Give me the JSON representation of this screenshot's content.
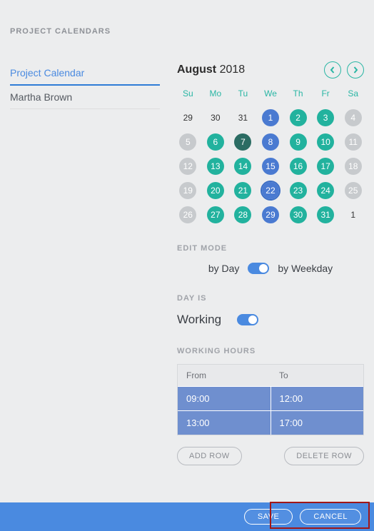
{
  "page_title": "PROJECT CALENDARS",
  "sidebar": {
    "items": [
      {
        "label": "Project Calendar",
        "active": true
      },
      {
        "label": "Martha Brown",
        "active": false
      }
    ]
  },
  "calendar": {
    "month_bold": "August",
    "year": "2018",
    "dow": [
      "Su",
      "Mo",
      "Tu",
      "We",
      "Th",
      "Fr",
      "Sa"
    ],
    "cells": [
      {
        "label": "29",
        "kind": "plain"
      },
      {
        "label": "30",
        "kind": "plain"
      },
      {
        "label": "31",
        "kind": "plain"
      },
      {
        "label": "1",
        "kind": "circle",
        "color": "c-blue"
      },
      {
        "label": "2",
        "kind": "circle",
        "color": "c-teal"
      },
      {
        "label": "3",
        "kind": "circle",
        "color": "c-teal"
      },
      {
        "label": "4",
        "kind": "circle",
        "color": "c-gray"
      },
      {
        "label": "5",
        "kind": "circle",
        "color": "c-gray"
      },
      {
        "label": "6",
        "kind": "circle",
        "color": "c-teal"
      },
      {
        "label": "7",
        "kind": "circle",
        "color": "c-dark"
      },
      {
        "label": "8",
        "kind": "circle",
        "color": "c-blue"
      },
      {
        "label": "9",
        "kind": "circle",
        "color": "c-teal"
      },
      {
        "label": "10",
        "kind": "circle",
        "color": "c-teal"
      },
      {
        "label": "11",
        "kind": "circle",
        "color": "c-gray"
      },
      {
        "label": "12",
        "kind": "circle",
        "color": "c-gray"
      },
      {
        "label": "13",
        "kind": "circle",
        "color": "c-teal"
      },
      {
        "label": "14",
        "kind": "circle",
        "color": "c-teal"
      },
      {
        "label": "15",
        "kind": "circle",
        "color": "c-blue"
      },
      {
        "label": "16",
        "kind": "circle",
        "color": "c-teal"
      },
      {
        "label": "17",
        "kind": "circle",
        "color": "c-teal"
      },
      {
        "label": "18",
        "kind": "circle",
        "color": "c-gray"
      },
      {
        "label": "19",
        "kind": "circle",
        "color": "c-gray"
      },
      {
        "label": "20",
        "kind": "circle",
        "color": "c-teal"
      },
      {
        "label": "21",
        "kind": "circle",
        "color": "c-teal"
      },
      {
        "label": "22",
        "kind": "circle",
        "color": "c-blue",
        "selected": true
      },
      {
        "label": "23",
        "kind": "circle",
        "color": "c-teal"
      },
      {
        "label": "24",
        "kind": "circle",
        "color": "c-teal"
      },
      {
        "label": "25",
        "kind": "circle",
        "color": "c-gray"
      },
      {
        "label": "26",
        "kind": "circle",
        "color": "c-gray"
      },
      {
        "label": "27",
        "kind": "circle",
        "color": "c-teal"
      },
      {
        "label": "28",
        "kind": "circle",
        "color": "c-teal"
      },
      {
        "label": "29",
        "kind": "circle",
        "color": "c-blue"
      },
      {
        "label": "30",
        "kind": "circle",
        "color": "c-teal"
      },
      {
        "label": "31",
        "kind": "circle",
        "color": "c-teal"
      },
      {
        "label": "1",
        "kind": "plain"
      }
    ]
  },
  "edit_mode": {
    "label": "EDIT MODE",
    "opt_day": "by Day",
    "opt_weekday": "by Weekday"
  },
  "day_is": {
    "label": "DAY IS",
    "value": "Working"
  },
  "working_hours": {
    "label": "WORKING HOURS",
    "header_from": "From",
    "header_to": "To",
    "rows": [
      {
        "from": "09:00",
        "to": "12:00"
      },
      {
        "from": "13:00",
        "to": "17:00"
      }
    ],
    "add_label": "ADD ROW",
    "delete_label": "DELETE ROW"
  },
  "footer": {
    "save": "SAVE",
    "cancel": "CANCEL"
  }
}
